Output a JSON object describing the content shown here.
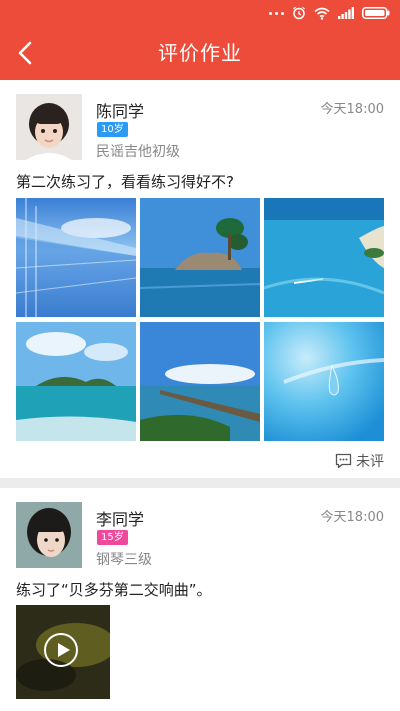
{
  "header": {
    "title": "评价作业"
  },
  "posts": [
    {
      "name": "陈同学",
      "age": "10岁",
      "age_color": "#2b9af3",
      "level": "民谣吉他初级",
      "time": "今天18:00",
      "message": "第二次练习了，看看练习得好不?",
      "status": "未评",
      "photos": [
        "glass-walkway-photo",
        "rocky-islet-photo",
        "beach-aerial-photo",
        "island-sea-photo",
        "pier-photo",
        "water-drop-photo"
      ]
    },
    {
      "name": "李同学",
      "age": "15岁",
      "age_color": "#f0489b",
      "level": "钢琴三级",
      "time": "今天18:00",
      "message": "练习了“贝多芬第二交响曲”。",
      "media": "video"
    }
  ]
}
